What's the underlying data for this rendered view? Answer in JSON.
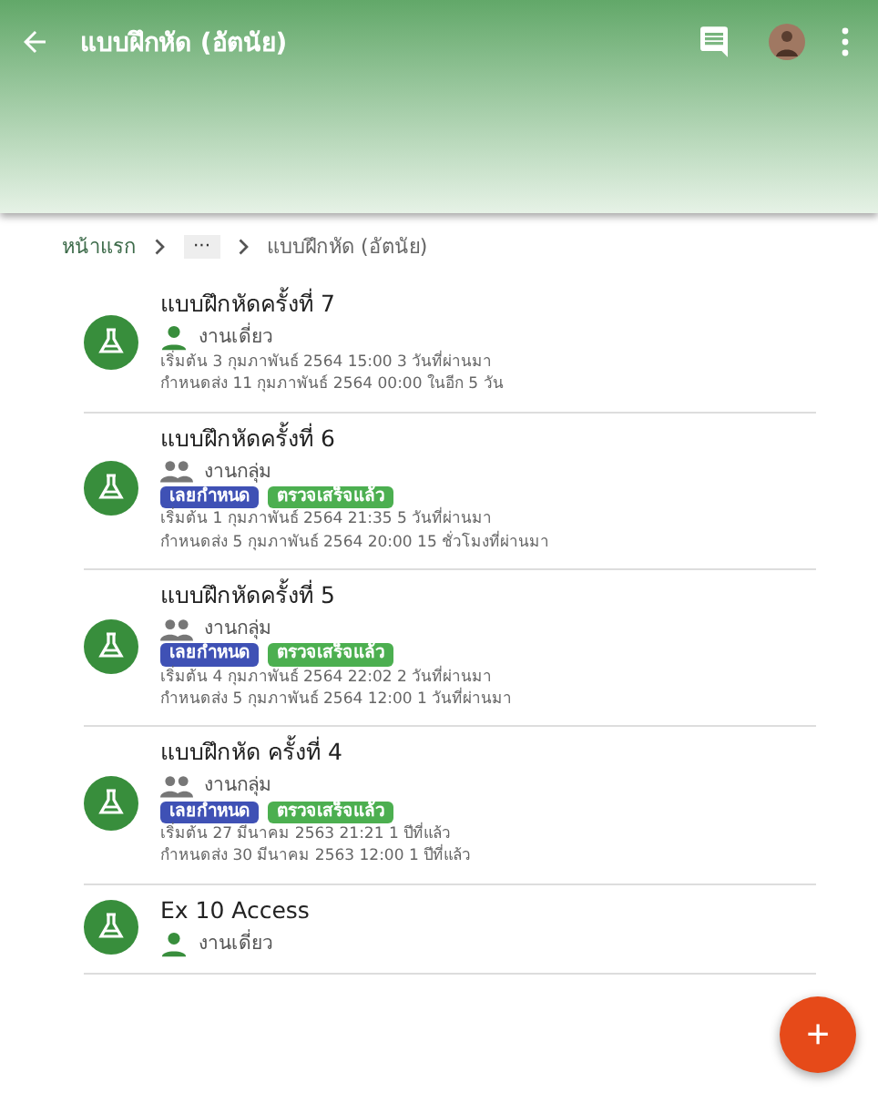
{
  "app_bar": {
    "title": "แบบฝึกหัด (อัตนัย)"
  },
  "breadcrumb": [
    {
      "label": "หน้าแรก",
      "kind": "link"
    },
    {
      "label": "···",
      "kind": "more"
    },
    {
      "label": "แบบฝึกหัด (อัตนัย)",
      "kind": "current"
    }
  ],
  "assignments": [
    {
      "title": "แบบฝึกหัดครั้งที่ 7",
      "kind": "single",
      "work_type": "งานเดี่ยว",
      "start": "เริ่มต้น 3 กุมภาพันธ์ 2564 15:00 3 วันที่ผ่านมา",
      "due": "กำหนดส่ง 11 กุมภาพันธ์ 2564 00:00 ในอีก 5 วัน"
    },
    {
      "title": "แบบฝึกหัดครั้งที่ 6",
      "kind": "group",
      "work_type": "งานกลุ่ม",
      "tags": [
        {
          "label": "เลยกำหนด",
          "color": "#3f51b5"
        },
        {
          "label": "ตรวจเสร็จแล้ว",
          "color": "#4caf50"
        }
      ],
      "start": "เริ่มต้น 1 กุมภาพันธ์ 2564 21:35 5 วันที่ผ่านมา",
      "due": "กำหนดส่ง 5 กุมภาพันธ์ 2564 20:00 15 ชั่วโมงที่ผ่านมา"
    },
    {
      "title": "แบบฝึกหัดครั้งที่ 5",
      "kind": "group",
      "work_type": "งานกลุ่ม",
      "tags": [
        {
          "label": "เลยกำหนด",
          "color": "#3f51b5"
        },
        {
          "label": "ตรวจเสร็จแล้ว",
          "color": "#4caf50"
        }
      ],
      "start": "เริ่มต้น 4 กุมภาพันธ์ 2564 22:02 2 วันที่ผ่านมา",
      "due": "กำหนดส่ง 5 กุมภาพันธ์ 2564 12:00 1 วันที่ผ่านมา"
    },
    {
      "title": "แบบฝึกหัด ครั้งที่ 4",
      "kind": "group",
      "work_type": "งานกลุ่ม",
      "tags": [
        {
          "label": "เลยกำหนด",
          "color": "#3f51b5"
        },
        {
          "label": "ตรวจเสร็จแล้ว",
          "color": "#4caf50"
        }
      ],
      "start": "เริ่มต้น 27 มีนาคม 2563 21:21 1 ปีที่แล้ว",
      "due": "กำหนดส่ง 30 มีนาคม 2563 12:00 1 ปีที่แล้ว"
    },
    {
      "title": "Ex 10 Access",
      "kind": "single",
      "work_type": "งานเดี่ยว"
    }
  ],
  "fab": {
    "label": "+"
  }
}
